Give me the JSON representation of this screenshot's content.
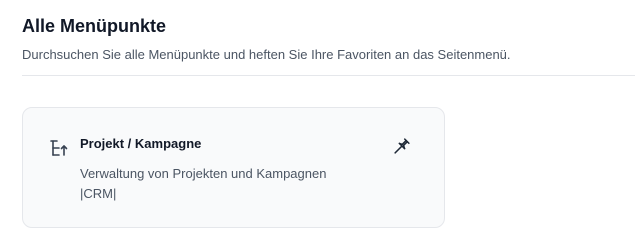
{
  "header": {
    "title": "Alle Menüpunkte",
    "subtitle": "Durchsuchen Sie alle Menüpunkte und heften Sie Ihre Favoriten an das Seitenmenü."
  },
  "menu_items": [
    {
      "title": "Projekt / Kampagne",
      "description": "Verwaltung von Projekten und Kampagnen",
      "tag": "|CRM|",
      "icon": "project-hierarchy-icon",
      "action_icon": "pin-icon"
    }
  ],
  "colors": {
    "text_primary": "#111827",
    "text_secondary": "#4b5563",
    "card_background": "#f9fafb",
    "border": "#e5e7eb"
  }
}
